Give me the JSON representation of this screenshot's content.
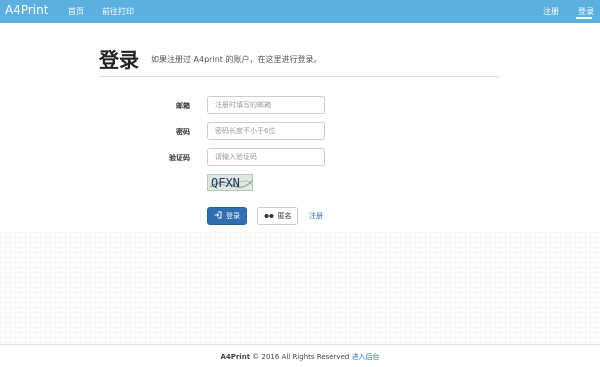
{
  "navbar": {
    "brand": "A4Print",
    "home": "首页",
    "print": "前往打印",
    "register": "注册",
    "login": "登录"
  },
  "page": {
    "title": "登录",
    "subtitle": "如果注册过 A4print 的账户，在这里进行登录。"
  },
  "form": {
    "email_label": "邮箱",
    "email_placeholder": "注册时填写的邮箱",
    "password_label": "密码",
    "password_placeholder": "密码长度不小于6位",
    "captcha_label": "验证码",
    "captcha_placeholder": "请输入验证码",
    "captcha_text": "QFXN",
    "login_button": "登录",
    "anon_button": "匿名",
    "register_link": "注册"
  },
  "footer": {
    "brand": "A4Print",
    "copyright": " © 2016 All Rights Reserved ",
    "admin_link": "进入后台"
  },
  "colors": {
    "navbar": "#5bb0df",
    "primary": "#2e6fb3"
  }
}
